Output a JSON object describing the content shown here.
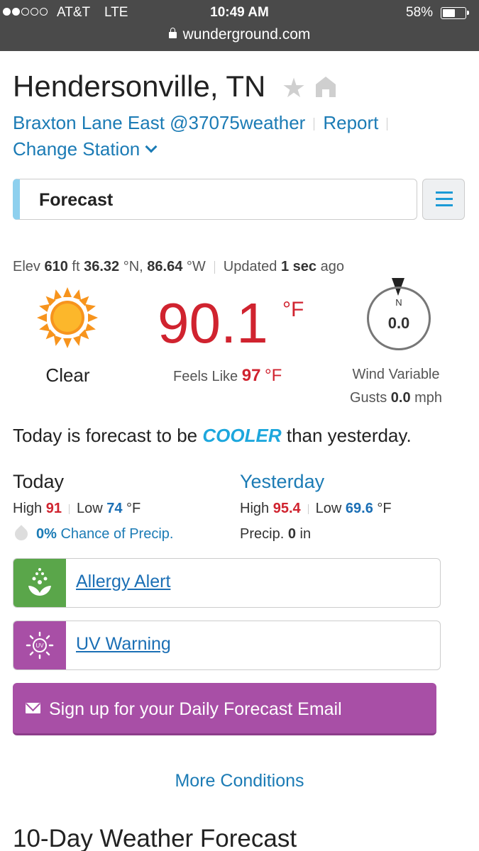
{
  "status_bar": {
    "carrier": "AT&T",
    "network": "LTE",
    "time": "10:49 AM",
    "battery": "58%",
    "battery_level": 0.58
  },
  "browser": {
    "url": "wunderground.com"
  },
  "header": {
    "city": "Hendersonville, TN",
    "station": "Braxton Lane East @37075weather",
    "report": "Report",
    "change_station": "Change Station"
  },
  "view_select": {
    "selected": "Forecast"
  },
  "conditions": {
    "elev_label": "Elev",
    "elev_value": "610",
    "elev_unit": "ft",
    "lat_value": "36.32",
    "lat_unit": "°N,",
    "lon_value": "86.64",
    "lon_unit": "°W",
    "updated_label": "Updated",
    "updated_value": "1 sec",
    "updated_suffix": "ago",
    "condition": "Clear",
    "temperature": "90.1",
    "temp_unit": "°F",
    "feels_like_label": "Feels Like",
    "feels_like_value": "97",
    "feels_like_unit": "°F",
    "compass_dir": "N",
    "wind_speed": "0.0",
    "wind_desc": "Wind Variable",
    "gusts_label": "Gusts",
    "gusts_value": "0.0",
    "gusts_unit": "mph"
  },
  "comparison": {
    "prefix": "Today is forecast to be",
    "word": "COOLER",
    "suffix": "than yesterday."
  },
  "today": {
    "title": "Today",
    "high_label": "High",
    "high": "91",
    "low_label": "Low",
    "low": "74",
    "unit": "°F",
    "precip_value": "0%",
    "precip_label": "Chance of Precip."
  },
  "yesterday": {
    "title": "Yesterday",
    "high_label": "High",
    "high": "95.4",
    "low_label": "Low",
    "low": "69.6",
    "unit": "°F",
    "precip_label": "Precip.",
    "precip_value": "0",
    "precip_unit": "in"
  },
  "alerts": [
    {
      "label": "Allergy Alert",
      "color": "#5aa64a",
      "icon": "allergy-icon"
    },
    {
      "label": "UV Warning",
      "color": "#a84fa6",
      "icon": "uv-icon"
    }
  ],
  "signup": {
    "label": "Sign up for your Daily Forecast Email",
    "color": "#a84fa6"
  },
  "more_conditions": "More Conditions",
  "ten_day_title": "10-Day Weather Forecast",
  "colors": {
    "temp_red": "#d0232f",
    "link_blue": "#1b7bb5",
    "cooler_blue": "#1da7dd",
    "topbar": "#4a4a4a"
  }
}
